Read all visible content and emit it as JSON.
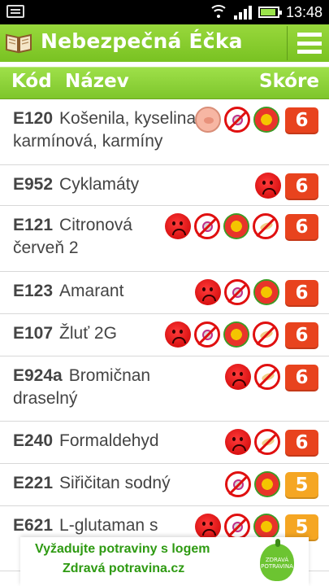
{
  "status_bar": {
    "time": "13:48"
  },
  "app_bar": {
    "title": "Nebezpečná Éčka"
  },
  "table_header": {
    "code": "Kód",
    "name": "Název",
    "score": "Skóre"
  },
  "colors": {
    "accent_green": "#7ec62c",
    "score_6": "#e8431e",
    "score_5": "#f5a623"
  },
  "rows": [
    {
      "code": "E120",
      "name": "Košenila, kyselina karmínová, karmíny",
      "score": "6",
      "icons": [
        "pig-icon",
        "no-baby-icon",
        "flower-icon"
      ]
    },
    {
      "code": "E952",
      "name": "Cyklamáty",
      "score": "6",
      "icons": [
        "sad-face-icon"
      ]
    },
    {
      "code": "E121",
      "name": "Citronová červeň 2",
      "score": "6",
      "icons": [
        "sad-face-icon",
        "no-baby-icon",
        "flower-icon",
        "no-gluten-icon"
      ]
    },
    {
      "code": "E123",
      "name": "Amarant",
      "score": "6",
      "icons": [
        "sad-face-icon",
        "no-baby-icon",
        "flower-icon"
      ]
    },
    {
      "code": "E107",
      "name": "Žluť 2G",
      "score": "6",
      "icons": [
        "sad-face-icon",
        "no-baby-icon",
        "flower-icon",
        "no-gluten-icon"
      ]
    },
    {
      "code": "E924a",
      "name": "Bromičnan draselný",
      "score": "6",
      "icons": [
        "sad-face-icon",
        "no-gluten-icon"
      ]
    },
    {
      "code": "E240",
      "name": "Formaldehyd",
      "score": "6",
      "icons": [
        "sad-face-icon",
        "no-gluten-icon"
      ]
    },
    {
      "code": "E221",
      "name": "Siřičitan sodný",
      "score": "5",
      "icons": [
        "no-baby-icon",
        "flower-icon"
      ]
    },
    {
      "code": "E621",
      "name": "L-glutaman s",
      "score": "5",
      "icons": [
        "sad-face-icon",
        "no-baby-icon",
        "flower-icon"
      ]
    }
  ],
  "ad_banner": {
    "line1": "Vyžadujte potraviny s logem",
    "line2": "Zdravá potravina.cz",
    "logo_text": "ZDRAVÁ POTRAVINA"
  }
}
